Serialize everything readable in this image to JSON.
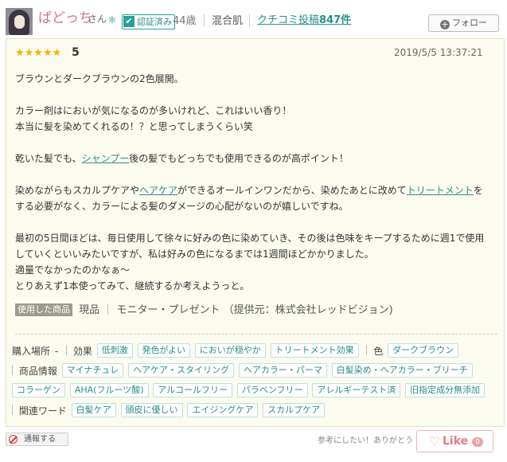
{
  "user": {
    "name": "ぱどっち",
    "honorific": "さん",
    "verified_label": "認証済み",
    "age": "44歳",
    "skin_type": "混合肌",
    "posts_label": "クチコミ投稿",
    "posts_count": "847件",
    "follow_label": "フォロー"
  },
  "review": {
    "rating": 5,
    "rating_label": "5",
    "stars": "★★★★★",
    "date": "2019/5/5 13:37:21",
    "paragraphs": {
      "p1": "ブラウンとダークブラウンの2色展開。",
      "p2a": "カラー剤はにおいが気になるのが多いけれど、これはいい香り！",
      "p2b": "本当に髪を染めてくれるの！？と思ってしまうくらい笑",
      "p3_pre": "乾いた髪でも、",
      "p3_link": "シャンプー",
      "p3_post": "後の髪でもどっちでも使用できるのが高ポイント！",
      "p4_pre": "染めながらもスカルプケアや",
      "p4_link1": "ヘアケア",
      "p4_mid": "ができるオールインワンだから、染めたあとに改めて",
      "p4_link2": "トリートメント",
      "p4_post": "をする必要がなく、カラーによる髪のダメージの心配がないのが嬉しいですね。",
      "p5a": "最初の5日間ほどは、毎日使用して徐々に好みの色に染めていき、その後は色味をキープするために週1で使用していくといいみたいですが、私は好みの色になるまでは1週間ほどかかりました。",
      "p5b": "適量でなかったのかなぁ～",
      "p5c": "とりあえず1本使ってみて、継続するか考えようっと。"
    },
    "product_label": "使用した商品",
    "product_type": "現品",
    "product_source": "モニター・プレゼント （提供元：株式会社レッドビジョン)"
  },
  "tags": {
    "purchase_label": "購入場所",
    "purchase_value": "-",
    "effect_label": "効果",
    "effects": [
      "低刺激",
      "発色がよい",
      "においが穏やか",
      "トリートメント効果"
    ],
    "color_label": "色",
    "colors": [
      "ダークブラウン"
    ],
    "product_info_label": "商品情報",
    "product_info": [
      "マイナチュレ",
      "ヘアケア・スタイリング",
      "ヘアカラー・パーマ",
      "白髪染め・ヘアカラー・ブリーチ",
      "コラーゲン",
      "AHA(フルーツ酸)",
      "アルコールフリー",
      "パラベンフリー",
      "アレルギーテスト済",
      "旧指定成分無添加"
    ],
    "keyword_label": "関連ワード",
    "keywords": [
      "白髪ケア",
      "頭皮に優しい",
      "エイジングケア",
      "スカルプケア"
    ]
  },
  "footer": {
    "report_label": "通報する",
    "helpful_label": "参考にしたい！ありがとう",
    "like_label": "Like",
    "like_count": "0"
  },
  "colors": {
    "accent_teal": "#2a8f87",
    "username_pink": "#d26e9e",
    "star_gold": "#f0b400",
    "review_bg": "#fcfbf0"
  }
}
